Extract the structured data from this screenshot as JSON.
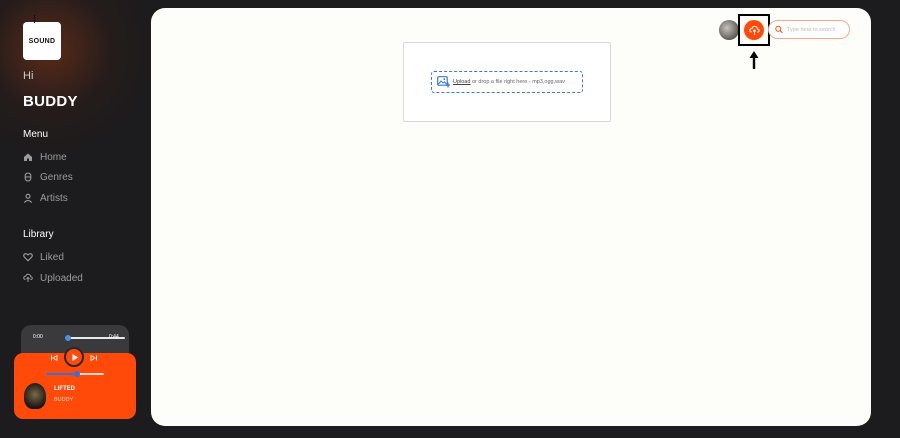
{
  "brand": {
    "logo_text": "SOUND"
  },
  "greeting": {
    "hi": "Hi",
    "username": "BUDDY"
  },
  "sidebar": {
    "menu_title": "Menu",
    "menu_items": [
      {
        "label": "Home",
        "icon": "home-icon"
      },
      {
        "label": "Genres",
        "icon": "genres-icon"
      },
      {
        "label": "Artists",
        "icon": "artist-icon"
      }
    ],
    "library_title": "Library",
    "library_items": [
      {
        "label": "Liked",
        "icon": "heart-icon"
      },
      {
        "label": "Uploaded",
        "icon": "cloud-upload-icon"
      }
    ]
  },
  "player": {
    "current_time": "0:00",
    "duration": "0:44",
    "progress": 0.0,
    "volume": 0.5,
    "track_title": "LIFTED",
    "track_artist": "BUDDY"
  },
  "header": {
    "search_placeholder": "Type here to search"
  },
  "upload": {
    "link_text": "Upload",
    "drop_text": " or drop a file right here",
    "formats": "mp3,ogg,wav"
  },
  "colors": {
    "accent": "#ff4a0a",
    "background": "#1c1b1d",
    "panel": "#fdfdf9",
    "dropzone_border": "#3a78d8"
  }
}
